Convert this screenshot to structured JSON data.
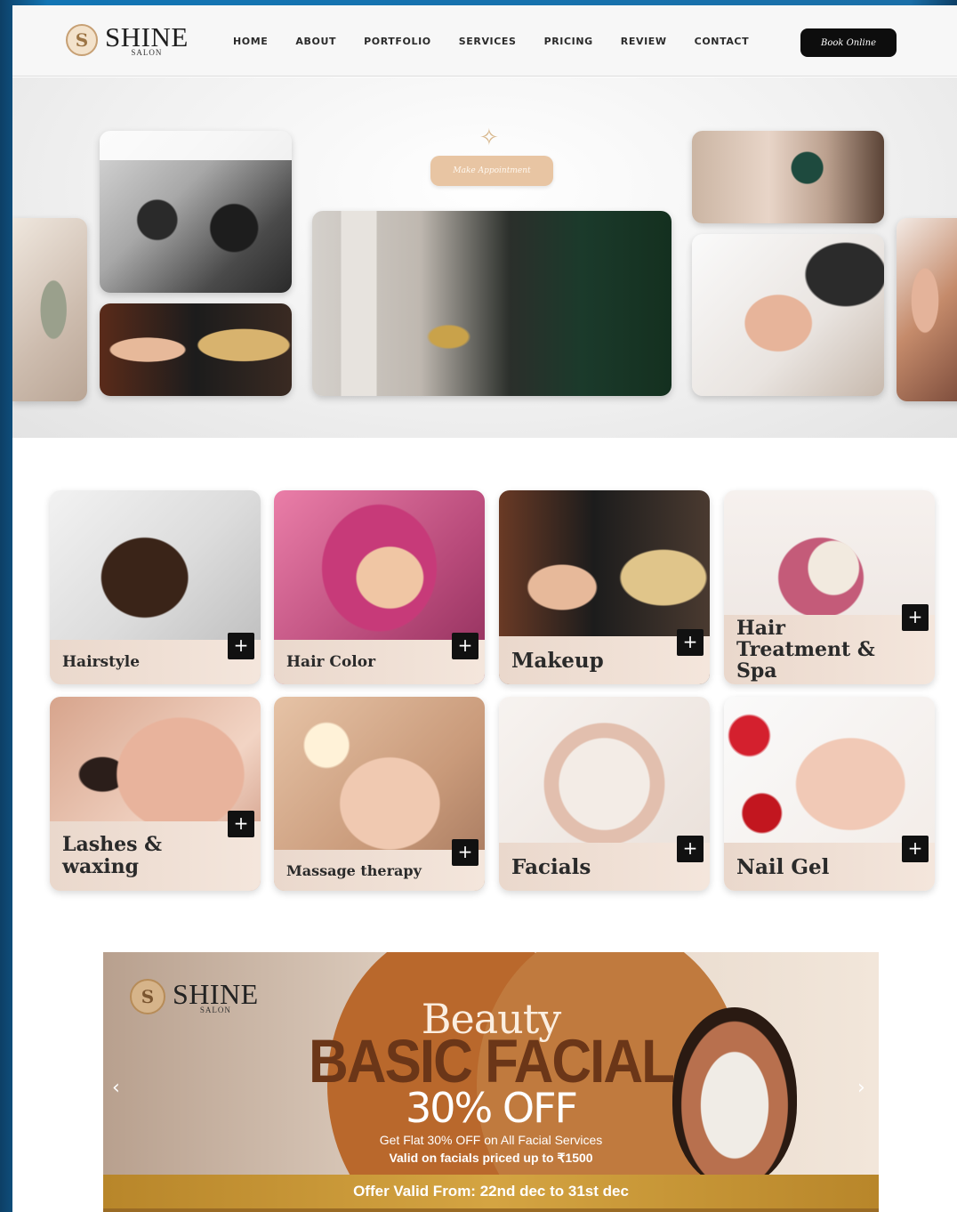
{
  "brand": {
    "name": "SHINE",
    "sub": "SALON",
    "badge": "S"
  },
  "nav": {
    "items": [
      "HOME",
      "ABOUT",
      "PORTFOLIO",
      "SERVICES",
      "PRICING",
      "REVIEW",
      "CONTACT"
    ],
    "book_label": "Book Online"
  },
  "hero": {
    "appointment_label": "Make Appointment",
    "sparkle_glyph": "✧"
  },
  "services": [
    {
      "label": "Hairstyle"
    },
    {
      "label": "Hair Color"
    },
    {
      "label": "Makeup"
    },
    {
      "label": "Hair Treatment & Spa"
    },
    {
      "label": "Lashes & waxing"
    },
    {
      "label": "Massage therapy"
    },
    {
      "label": "Facials"
    },
    {
      "label": "Nail Gel"
    }
  ],
  "plus_glyph": "+",
  "banner": {
    "logo_name": "SHINE",
    "logo_sub": "SALON",
    "title_script": "Beauty",
    "title_main": "BASIC FACIAL",
    "discount": "30% OFF",
    "line1": "Get Flat 30% OFF on All Facial Services",
    "line2": "Valid on facials priced up to ₹1500",
    "strip": "Offer Valid From: 22nd dec to 31st dec",
    "prev_arrow": "‹",
    "next_arrow": "›"
  },
  "colors": {
    "accent": "#e8c5a3",
    "dark": "#0d0d0d",
    "banner_orange": "#b9682c",
    "banner_gold": "#d4a442"
  }
}
